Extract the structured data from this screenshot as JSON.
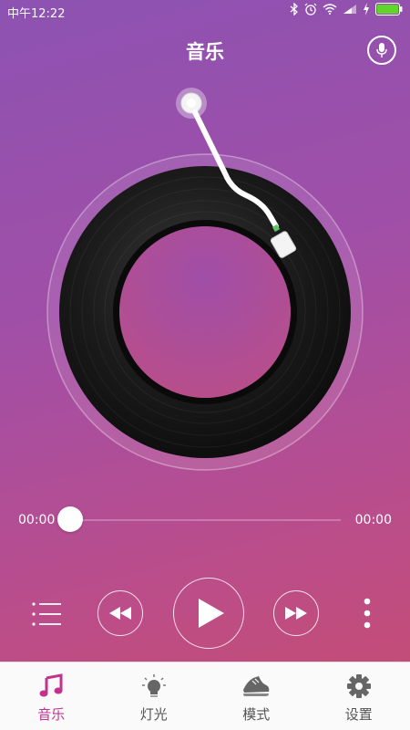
{
  "status_bar": {
    "time": "中午12:22"
  },
  "header": {
    "title": "音乐"
  },
  "player": {
    "elapsed": "00:00",
    "duration": "00:00",
    "progress": 0
  },
  "tabs": [
    {
      "label": "音乐",
      "icon": "music-note-icon",
      "active": true
    },
    {
      "label": "灯光",
      "icon": "light-bulb-icon",
      "active": false
    },
    {
      "label": "模式",
      "icon": "shoe-icon",
      "active": false
    },
    {
      "label": "设置",
      "icon": "gear-icon",
      "active": false
    }
  ],
  "colors": {
    "accent": "#c2338e",
    "bg_top": "#8d52b2",
    "bg_bottom": "#c84d70"
  }
}
